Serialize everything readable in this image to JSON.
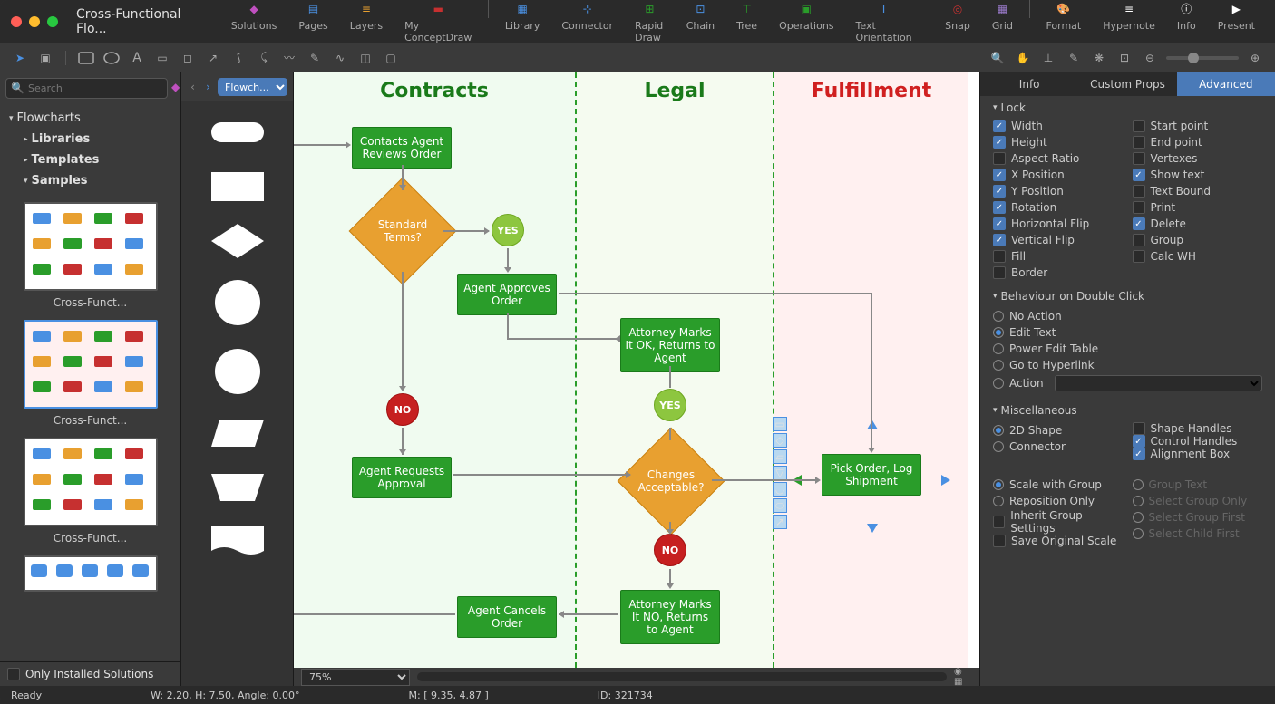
{
  "window_title": "Cross-Functional Flo...",
  "main_menu": [
    {
      "label": "Solutions",
      "color": "#c050c0"
    },
    {
      "label": "Pages",
      "color": "#4a90e2"
    },
    {
      "label": "Layers",
      "color": "#e8a030"
    },
    {
      "label": "My ConceptDraw",
      "color": "#c63030"
    },
    {
      "label": "Library",
      "color": "#4a90e2",
      "sep": true
    },
    {
      "label": "Connector",
      "color": "#4a90e2"
    },
    {
      "label": "Rapid Draw",
      "color": "#2a9d2a"
    },
    {
      "label": "Chain",
      "color": "#4a90e2"
    },
    {
      "label": "Tree",
      "color": "#2a9d2a"
    },
    {
      "label": "Operations",
      "color": "#2a9d2a"
    },
    {
      "label": "Text Orientation",
      "color": "#4a90e2"
    },
    {
      "label": "Snap",
      "color": "#c63030",
      "sep": true
    },
    {
      "label": "Grid",
      "color": "#9a7aca"
    },
    {
      "label": "Format",
      "color": "#fff",
      "sep": true
    },
    {
      "label": "Hypernote",
      "color": "#fff"
    },
    {
      "label": "Info",
      "color": "#fff"
    },
    {
      "label": "Present",
      "color": "#fff"
    }
  ],
  "search_placeholder": "Search",
  "tree": {
    "root": "Flowcharts",
    "items": [
      "Libraries",
      "Templates",
      "Samples"
    ]
  },
  "thumbnails": [
    {
      "label": "Cross-Funct..."
    },
    {
      "label": "Cross-Funct...",
      "selected": true
    },
    {
      "label": "Cross-Funct..."
    }
  ],
  "only_installed": "Only Installed Solutions",
  "shapes_dropdown": "Flowch...",
  "lanes": {
    "contracts": "Contracts",
    "legal": "Legal",
    "fulfillment": "Fulfillment"
  },
  "nodes": {
    "contacts_review": "Contacts Agent Reviews Order",
    "standard_terms": "Standard Terms?",
    "yes1": "YES",
    "agent_approves": "Agent Approves Order",
    "no1": "NO",
    "agent_requests": "Agent Requests Approval",
    "agent_cancels": "Agent Cancels Order",
    "attorney_ok": "Attorney Marks It OK, Returns to Agent",
    "yes2": "YES",
    "changes_acceptable": "Changes Acceptable?",
    "no2": "NO",
    "attorney_no": "Attorney Marks It NO, Returns to Agent",
    "pick_order": "Pick Order, Log Shipment"
  },
  "zoom": "75%",
  "tabs": {
    "info": "Info",
    "custom": "Custom Props",
    "advanced": "Advanced"
  },
  "lock": {
    "header": "Lock",
    "items": [
      {
        "label": "Width",
        "checked": true
      },
      {
        "label": "Start point",
        "checked": false
      },
      {
        "label": "Height",
        "checked": true
      },
      {
        "label": "End point",
        "checked": false
      },
      {
        "label": "Aspect Ratio",
        "checked": false
      },
      {
        "label": "Vertexes",
        "checked": false
      },
      {
        "label": "X Position",
        "checked": true
      },
      {
        "label": "Show text",
        "checked": true
      },
      {
        "label": "Y Position",
        "checked": true
      },
      {
        "label": "Text Bound",
        "checked": false
      },
      {
        "label": "Rotation",
        "checked": true
      },
      {
        "label": "Print",
        "checked": false
      },
      {
        "label": "Horizontal Flip",
        "checked": true
      },
      {
        "label": "Delete",
        "checked": true
      },
      {
        "label": "Vertical Flip",
        "checked": true
      },
      {
        "label": "Group",
        "checked": false
      },
      {
        "label": "Fill",
        "checked": false
      },
      {
        "label": "Calc WH",
        "checked": false
      },
      {
        "label": "Border",
        "checked": false
      }
    ]
  },
  "dblclick": {
    "header": "Behaviour on Double Click",
    "options": [
      "No Action",
      "Edit Text",
      "Power Edit Table",
      "Go to Hyperlink",
      "Action"
    ],
    "selected": "Edit Text"
  },
  "misc": {
    "header": "Miscellaneous",
    "shape_radios": [
      "2D Shape",
      "Connector"
    ],
    "shape_selected": "2D Shape",
    "checks": [
      {
        "label": "Shape Handles",
        "checked": false
      },
      {
        "label": "Control Handles",
        "checked": true
      },
      {
        "label": "Alignment Box",
        "checked": true
      }
    ],
    "group_radios": [
      "Scale with Group",
      "Reposition Only"
    ],
    "group_selected": "Scale with Group",
    "group_checks": [
      {
        "label": "Inherit Group Settings",
        "checked": false
      },
      {
        "label": "Save Original Scale",
        "checked": false
      }
    ],
    "select_radios": [
      "Group Text",
      "Select Group Only",
      "Select Group First",
      "Select Child First"
    ]
  },
  "status": {
    "ready": "Ready",
    "size": "W: 2.20,  H: 7.50,  Angle: 0.00°",
    "mouse": "M: [ 9.35, 4.87 ]",
    "id": "ID: 321734"
  }
}
